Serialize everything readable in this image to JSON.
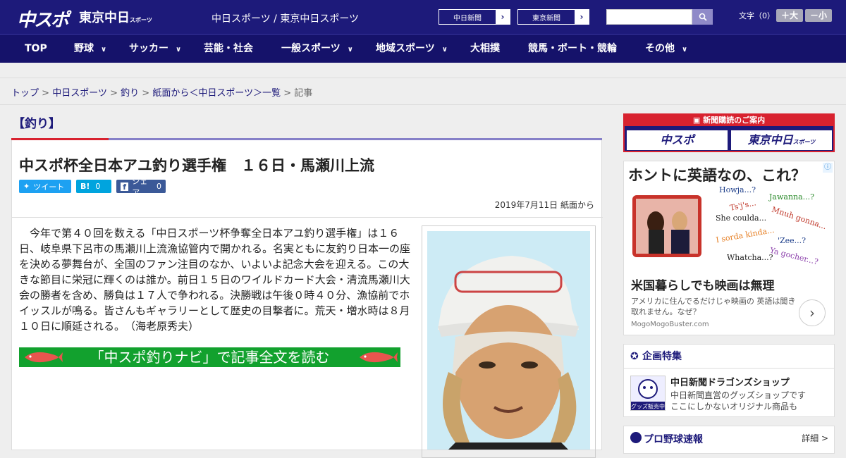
{
  "header": {
    "logo_chuspo": "中スポ",
    "logo_tokyo": "東京中日",
    "logo_tokyo_small": "スポーツ",
    "site_names": "中日スポーツ / 東京中日スポーツ",
    "btn_chunichi": "中日新聞",
    "btn_tokyo": "東京新聞",
    "search_placeholder": "",
    "font_label": "文字（0）",
    "font_bigger": "＋大",
    "font_smaller": "－小"
  },
  "nav": {
    "items": [
      {
        "label": "TOP"
      },
      {
        "label": "野球"
      },
      {
        "label": "サッカー"
      },
      {
        "label": "芸能・社会"
      },
      {
        "label": "一般スポーツ"
      },
      {
        "label": "地域スポーツ"
      },
      {
        "label": "大相撲"
      },
      {
        "label": "競馬・ボート・競輪"
      },
      {
        "label": "その他"
      }
    ]
  },
  "breadcrumb": {
    "items": [
      "トップ",
      "中日スポーツ",
      "釣り",
      "紙面から＜中日スポーツ＞一覧"
    ],
    "current": "記事",
    "separator": ">"
  },
  "article": {
    "category": "【釣り】",
    "title": "中スポ杯全日本アユ釣り選手権　１６日・馬瀬川上流",
    "share_tweet": "ツイート",
    "share_hatena_label": "B!",
    "share_hatena_count": "0",
    "share_fb_label": "シェア",
    "share_fb_count": "0",
    "date": "2019年7月11日 紙面から",
    "body": "　今年で第４０回を数える「中日スポーツ杯争奪全日本アユ釣り選手権」は１６日、岐阜県下呂市の馬瀬川上流漁協管内で開かれる。名実ともに友釣り日本一の座を決める夢舞台が、全国のファン注目のなか、いよいよ記念大会を迎える。この大きな節目に栄冠に輝くのは誰か。前日１５日のワイルドカード大会・清流馬瀬川大会の勝者を含め、勝負は１７人で争われる。決勝戦は午後０時４０分、漁協前でホイッスルが鳴る。皆さんもギャラリーとして歴史の目撃者に。荒天・増水時は８月１０日に順延される。　（海老原秀夫）",
    "navi_banner": "「中スポ釣りナビ」で記事全文を読む"
  },
  "sidebar": {
    "subscribe_title": "新聞購読のご案内",
    "subscribe_chuspo": "中スポ",
    "subscribe_tokyo": "東京中日",
    "subscribe_tokyo_small": "スポーツ",
    "ad": {
      "headline": "ホントに英語なの、これ？",
      "phrases": [
        "Howja...?",
        "Jawanna...?",
        "Ts'j's...",
        "She coulda...",
        "Mnuh gonna...",
        "I sorda kinda...",
        "'Zee...?",
        "Whatcha...?",
        "Ya gocher...?"
      ],
      "title": "米国暮らしでも映画は無理",
      "desc": "アメリカに住んでるだけじゃ映画の 英語は聞き取れません。なぜ？",
      "source": "MogoMogoBuster.com"
    },
    "feature": {
      "heading": "企画特集",
      "item_title": "中日新聞ドラゴンズショップ",
      "item_desc1": "中日新聞直営のグッズショップです",
      "item_desc2": "ここにしかないオリジナル商品も",
      "thumb_label": "グッズ販売中"
    },
    "baseball": {
      "heading": "プロ野球速報",
      "more": "詳細 >"
    }
  },
  "colors": {
    "header_bg": "#1d1a7a",
    "nav_bg": "#15126a",
    "accent_red": "#d8222f",
    "banner_green": "#12a12e",
    "twitter": "#1da1f2",
    "hatena": "#00a4de",
    "facebook": "#3b5998"
  }
}
